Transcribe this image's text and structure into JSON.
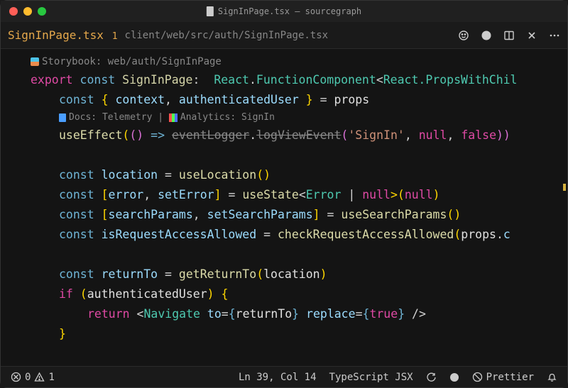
{
  "window": {
    "title": "SignInPage.tsx — sourcegraph"
  },
  "tab": {
    "filename": "SignInPage.tsx",
    "modified_indicator": "1",
    "breadcrumb": "client/web/src/auth/SignInPage.tsx"
  },
  "codelens": {
    "storybook": "Storybook: web/auth/SignInPage",
    "docs_label": "Docs: Telemetry",
    "sep": " | ",
    "analytics_label": "Analytics: SignIn"
  },
  "code": {
    "l1": {
      "export": "export",
      "const": "const",
      "name": "SignInPage",
      "colon": ":",
      "react": "React",
      "dot": ".",
      "fc": "FunctionComponent",
      "lt": "<",
      "propswith": "React.PropsWithChil"
    },
    "l2": {
      "const": "const",
      "lb": "{ ",
      "ctx": "context",
      "comma": ", ",
      "auth": "authenticatedUser",
      "rb": " }",
      "eq": " = ",
      "props": "props"
    },
    "l3": {
      "call": "useEffect",
      "lp": "(",
      "unit": "()",
      "arrow": " => ",
      "ev": "eventLogger",
      "dot": ".",
      "log": "logViewEvent",
      "lp2": "(",
      "str": "'SignIn'",
      "c1": ", ",
      "null": "null",
      "c2": ", ",
      "false": "false",
      "rp": "))"
    },
    "l4": {
      "const": "const",
      "loc": "location",
      "eq": " = ",
      "call": "useLocation",
      "parens": "()"
    },
    "l5": {
      "const": "const",
      "lb": "[",
      "err": "error",
      "c": ", ",
      "set": "setError",
      "rb": "]",
      "eq": " = ",
      "call": "useState",
      "lt": "<",
      "etype": "Error",
      "pipe": " | ",
      "null": "null",
      "gt": ">(",
      "nullv": "null",
      "rp": ")"
    },
    "l6": {
      "const": "const",
      "lb": "[",
      "sp": "searchParams",
      "c": ", ",
      "ssp": "setSearchParams",
      "rb": "]",
      "eq": " = ",
      "call": "useSearchParams",
      "parens": "()"
    },
    "l7": {
      "const": "const",
      "name": "isRequestAccessAllowed",
      "eq": " = ",
      "call": "checkRequestAccessAllowed",
      "lp": "(",
      "props": "props",
      "dot": ".",
      "cont": "c"
    },
    "l8": {
      "const": "const",
      "name": "returnTo",
      "eq": " = ",
      "call": "getReturnTo",
      "lp": "(",
      "arg": "location",
      "rp": ")"
    },
    "l9": {
      "if": "if",
      "lp": " (",
      "cond": "authenticatedUser",
      "rp": ") ",
      "lb": "{"
    },
    "l10": {
      "return": "return",
      "lt": " <",
      "tag": "Navigate",
      "sp": " ",
      "to": "to",
      "eq": "=",
      "lb": "{",
      "v": "returnTo",
      "rb": "}",
      "sp2": " ",
      "repl": "replace",
      "eq2": "=",
      "lb2": "{",
      "true": "true",
      "rb2": "}",
      "close": " />"
    },
    "l11": {
      "rb": "}"
    }
  },
  "status": {
    "errors": "0",
    "warnings": "1",
    "position": "Ln 39, Col 14",
    "language": "TypeScript JSX",
    "prettier": "Prettier"
  }
}
